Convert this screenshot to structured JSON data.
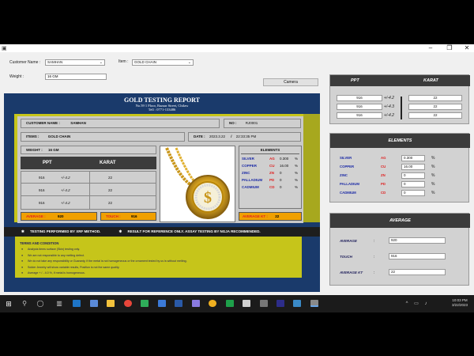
{
  "window": {
    "app_icon": "app-icon",
    "min": "–",
    "max": "❐",
    "close": "✕"
  },
  "form": {
    "customer_label": "Customer Name :",
    "customer_value": "SAMHAN",
    "item_label": "Item :",
    "item_value": "GOLD CHAIN",
    "weight_label": "Weight :",
    "weight_value": "16 GM",
    "camera_button": "Camera"
  },
  "report": {
    "title": "GOLD TESTING REPORT",
    "address": "No.59 1 Floor, Bazaar Street, Chilaw",
    "tel": "Tell : 0771-133486",
    "customer_label": "CUSTOMER NAME :",
    "customer_value": "SAMHAN",
    "no_label": "NO :",
    "no_value": "RJ0001",
    "items_label": "ITEMS :",
    "items_value": "GOLD CHAIN",
    "date_label": "DATE :",
    "date_value": "2023.3.22",
    "time_sep": "/",
    "time_value": "22:33:35 PM",
    "weight_label": "WEIGHT :",
    "weight_value": "16 GM",
    "ppt_header": "PPT",
    "karat_header": "KARAT",
    "rows": [
      {
        "ppt": "916",
        "tol": "+/-4.2",
        "karat": "22"
      },
      {
        "ppt": "916",
        "tol": "+/-4.2",
        "karat": "22"
      },
      {
        "ppt": "916",
        "tol": "+/-4.2",
        "karat": "22"
      }
    ],
    "average_label": "AVERAGE :",
    "average_value": "920",
    "touch_label": "TOUCH :",
    "touch_value": "916",
    "elements_title": "ELEMENTS",
    "elements": [
      {
        "name": "SILVER",
        "sym": "AG",
        "val": "0.300",
        "unit": "%"
      },
      {
        "name": "COPPER",
        "sym": "CU",
        "val": "16.00",
        "unit": "%"
      },
      {
        "name": "ZINC",
        "sym": "ZN",
        "val": "0",
        "unit": "%"
      },
      {
        "name": "PALLADIUM",
        "sym": "PD",
        "val": "0",
        "unit": "%"
      },
      {
        "name": "CADMIUM",
        "sym": "CD",
        "val": "0",
        "unit": "%"
      }
    ],
    "average_kt_label": "AVERAGE KT :",
    "average_kt_value": "22",
    "strip_left": "TESTING PERFORMED BY XRF METHOD.",
    "strip_right": "RESULT FOR REFERENCE ONLY. ASSAY TESTING BY NGJA RECOMMENDED.",
    "strip_bullet": "✱",
    "terms_title": "TERMS AND CONDITION",
    "terms": [
      "Analysis items surface (Skin) testing only.",
      "We are not responsible to any melting defect.",
      "We do not take any responsibility or Guaranty, if the metal is not homogeneous or the ornament tested by us is without melting.",
      "Solder Jewelry will show variable results, Position is not the same quality.",
      "Average + / - 4.0 %, if metal is homogeneous."
    ]
  },
  "ppt_panel": {
    "ppt_header": "PPT",
    "karat_header": "KARAT",
    "rows": [
      {
        "ppt": "916",
        "tol": "+/-4.2",
        "karat": "22"
      },
      {
        "ppt": "916",
        "tol": "+/-4.3",
        "karat": "22"
      },
      {
        "ppt": "916",
        "tol": "+/-4.2",
        "karat": "22"
      }
    ]
  },
  "elements_panel": {
    "title": "ELEMENTS",
    "rows": [
      {
        "name": "SILVER",
        "sym": "AG",
        "val": "0.300",
        "unit": "%"
      },
      {
        "name": "COPPER",
        "sym": "CU",
        "val": "16.00",
        "unit": "%"
      },
      {
        "name": "ZINC",
        "sym": "ZN",
        "val": "0",
        "unit": "%"
      },
      {
        "name": "PALLADIUM",
        "sym": "PD",
        "val": "0",
        "unit": "%"
      },
      {
        "name": "CADMIUM",
        "sym": "CD",
        "val": "0",
        "unit": "%"
      }
    ]
  },
  "average_panel": {
    "title": "AVERAGE",
    "average_label": "AVERAGE",
    "average_value": "920",
    "touch_label": "TOUCH",
    "touch_value": "916",
    "avg_kt_label": "AVERAGE KT",
    "avg_kt_value": "22",
    "colon": ":"
  },
  "taskbar": {
    "time": "10:03 PM",
    "date": "3/22/2023"
  },
  "colors": {
    "report_blue": "#1a3a6b",
    "olive": "#c6c51a",
    "orange": "#f0a000",
    "dark": "#3b3b3b"
  }
}
